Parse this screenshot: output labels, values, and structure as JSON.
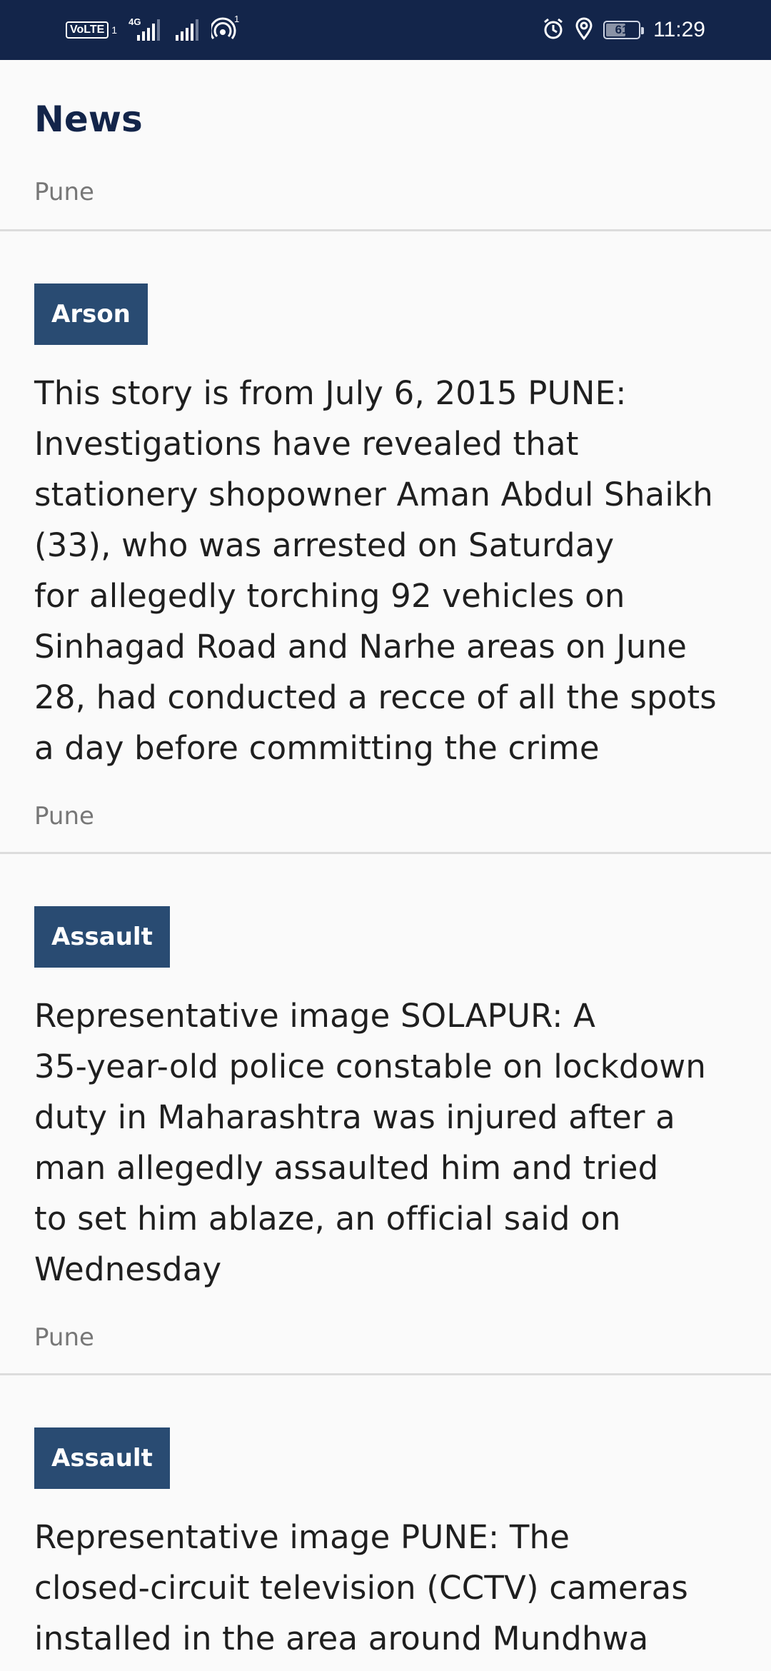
{
  "status_bar": {
    "volte_label": "VoLTE",
    "sim_slot": "1",
    "network_type": "4G",
    "hotspot_count": "1",
    "battery_percent": 61,
    "battery_label": "61",
    "time": "11:29",
    "icons": [
      "signal-icon",
      "wifi-hotspot-icon",
      "alarm-icon",
      "location-icon",
      "battery-icon"
    ]
  },
  "header": {
    "title": "News",
    "location": "Pune"
  },
  "news": [
    {
      "category": "Arson",
      "headline": "This story is from July 6, 2015 PUNE:\nInvestigations have revealed that\nstationery shopowner Aman Abdul Shaikh\n(33), who was arrested on Saturday\nfor allegedly torching 92 vehicles on\nSinhagad Road and Narhe areas on June\n28, had conducted a recce of all the spots\na day before committing the crime",
      "location": "Pune"
    },
    {
      "category": "Assault",
      "headline": "Representative image SOLAPUR: A\n35-year-old police constable on lockdown\nduty in Maharashtra was injured after a\nman allegedly assaulted him and tried\nto set him ablaze, an official said on\nWednesday",
      "location": "Pune"
    },
    {
      "category": "Assault",
      "headline": "Representative image PUNE: The\nclosed-circuit television (CCTV) cameras\ninstalled in the area around Mundhwa",
      "location": ""
    }
  ],
  "colors": {
    "status_bar_bg": "#13254a",
    "title_color": "#13254a",
    "badge_bg": "#294b72",
    "page_bg": "#fafafa"
  }
}
